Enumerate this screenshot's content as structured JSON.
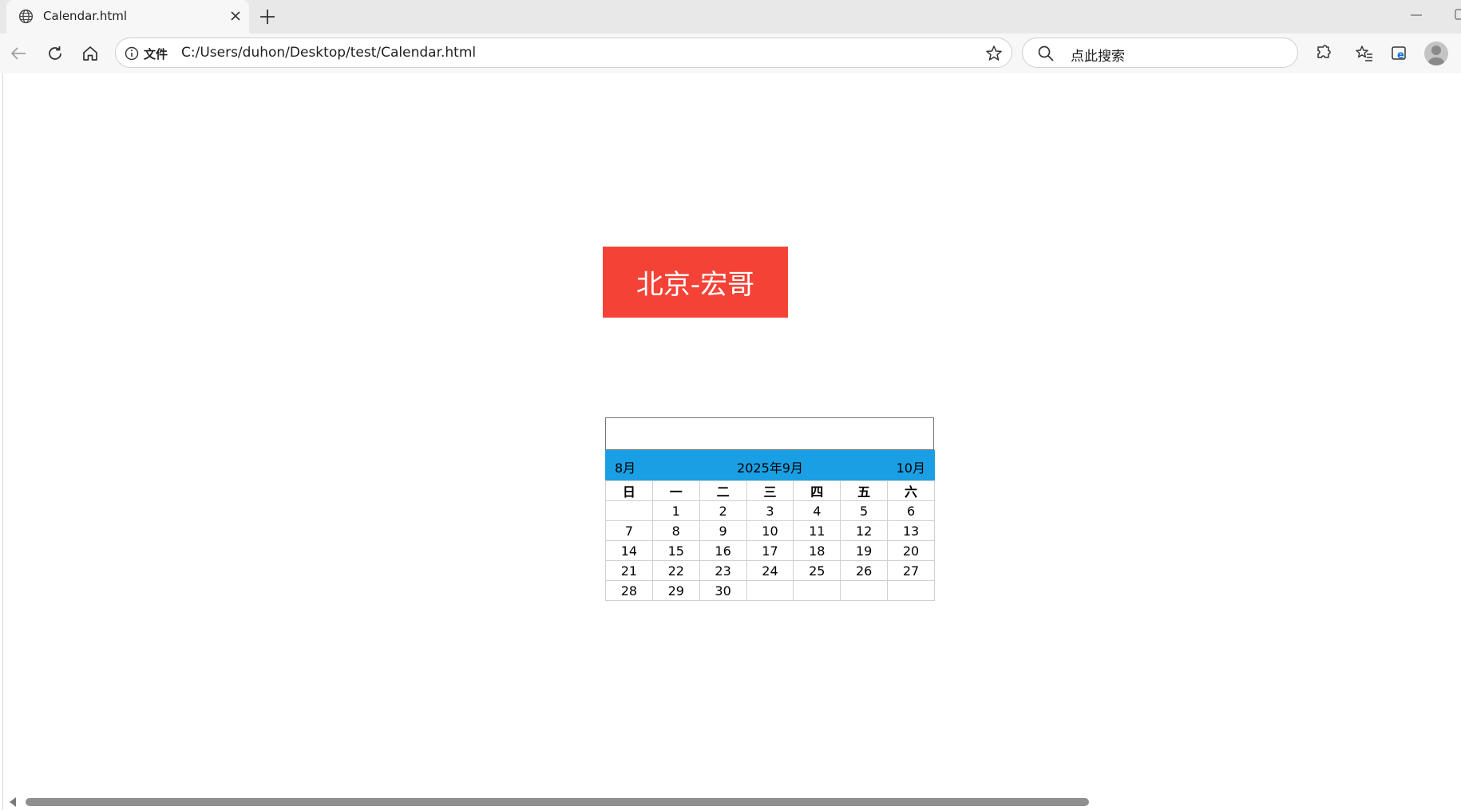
{
  "browser": {
    "tab_title": "Calendar.html",
    "address_protocol_label": "文件",
    "address_url": "C:/Users/duhon/Desktop/test/Calendar.html",
    "search_placeholder": "点此搜索"
  },
  "page": {
    "banner_text": "北京-宏哥",
    "date_input_value": "",
    "calendar": {
      "prev_month": "8月",
      "current_month": "2025年9月",
      "next_month": "10月",
      "weekdays": [
        "日",
        "一",
        "二",
        "三",
        "四",
        "五",
        "六"
      ],
      "weeks": [
        [
          "",
          "1",
          "2",
          "3",
          "4",
          "5",
          "6"
        ],
        [
          "7",
          "8",
          "9",
          "10",
          "11",
          "12",
          "13"
        ],
        [
          "14",
          "15",
          "16",
          "17",
          "18",
          "19",
          "20"
        ],
        [
          "21",
          "22",
          "23",
          "24",
          "25",
          "26",
          "27"
        ],
        [
          "28",
          "29",
          "30",
          "",
          "",
          "",
          ""
        ]
      ]
    }
  },
  "colors": {
    "banner_bg": "#f44336",
    "calendar_header_bg": "#1a9fe4"
  }
}
